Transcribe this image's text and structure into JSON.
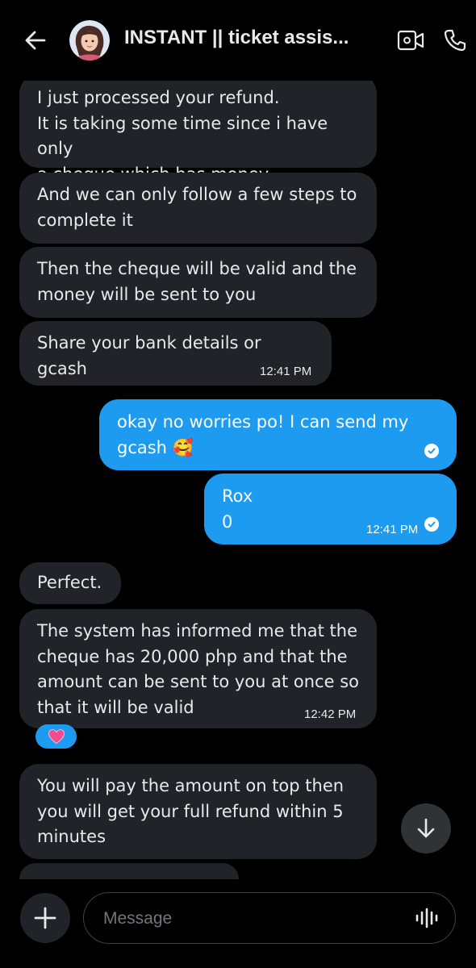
{
  "header": {
    "title": "INSTANT || ticket assis...",
    "icons": {
      "back": "arrow-left-icon",
      "video": "video-camera-icon",
      "call": "phone-icon",
      "avatar": "avatar"
    }
  },
  "messages": [
    {
      "direction": "in",
      "lines": [
        "I just processed your refund.",
        "It is taking some time since i have only",
        "a cheque which has money"
      ]
    },
    {
      "direction": "in",
      "lines": [
        "And we can only follow a few steps to",
        "complete it"
      ]
    },
    {
      "direction": "in",
      "lines": [
        "Then the cheque will be valid and the",
        "money will be sent to you"
      ]
    },
    {
      "direction": "in",
      "lines": [
        "Share your bank details or gcash"
      ],
      "time": "12:41 PM"
    },
    {
      "direction": "out",
      "lines": [
        "okay no worries po! I can send my",
        "gcash 🥰"
      ],
      "read": true
    },
    {
      "direction": "out",
      "lines": [
        "Rox",
        "0"
      ],
      "time": "12:41 PM",
      "read": true
    },
    {
      "direction": "in",
      "lines": [
        "Perfect."
      ]
    },
    {
      "direction": "in",
      "lines": [
        "The system has informed me that the",
        "cheque has 20,000 php and that the",
        "amount can be sent to you at once so",
        "that it will be valid"
      ],
      "time": "12:42 PM",
      "reaction": "heart"
    },
    {
      "direction": "in",
      "lines": [
        "You will pay the amount on top then",
        "you will get your full refund within 5",
        "minutes"
      ]
    }
  ],
  "composer": {
    "placeholder": "Message",
    "icons": {
      "add": "plus-icon",
      "voice": "voice-wave-icon",
      "scroll": "arrow-down-icon"
    }
  },
  "colors": {
    "background": "#000000",
    "incoming_bubble": "#202327",
    "outgoing_bubble": "#1d9bf0",
    "text": "#e7e9ea"
  }
}
